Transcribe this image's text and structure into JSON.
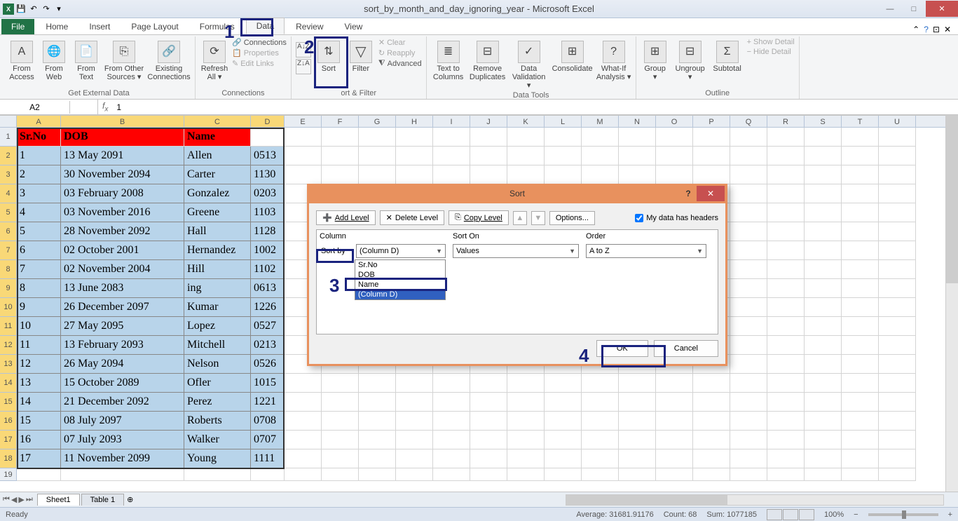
{
  "title": "sort_by_month_and_day_ignoring_year - Microsoft Excel",
  "tabs": [
    "File",
    "Home",
    "Insert",
    "Page Layout",
    "Formulas",
    "Data",
    "Review",
    "View"
  ],
  "active_tab": "Data",
  "ribbon": {
    "get_ext": {
      "from_access": "From\nAccess",
      "from_web": "From\nWeb",
      "from_text": "From\nText",
      "from_other": "From Other\nSources ▾",
      "existing": "Existing\nConnections",
      "label": "Get External Data"
    },
    "conn": {
      "refresh": "Refresh\nAll ▾",
      "connections": "Connections",
      "properties": "Properties",
      "edit_links": "Edit Links",
      "label": "Connections"
    },
    "sort": {
      "sort": "Sort",
      "filter": "Filter",
      "clear": "Clear",
      "reapply": "Reapply",
      "advanced": "Advanced",
      "label": "ort & Filter"
    },
    "tools": {
      "ttc": "Text to\nColumns",
      "rd": "Remove\nDuplicates",
      "dv": "Data\nValidation ▾",
      "cons": "Consolidate",
      "wia": "What-If\nAnalysis ▾",
      "label": "Data Tools"
    },
    "outline": {
      "group": "Group\n▾",
      "ungroup": "Ungroup\n▾",
      "subtotal": "Subtotal",
      "show": "Show Detail",
      "hide": "Hide Detail",
      "label": "Outline"
    }
  },
  "namebox": "A2",
  "formula": "1",
  "col_widths": {
    "A": 63,
    "B": 176,
    "C": 95,
    "D": 48,
    "rest": 53
  },
  "columns": [
    "A",
    "B",
    "C",
    "D",
    "E",
    "F",
    "G",
    "H",
    "I",
    "J",
    "K",
    "L",
    "M",
    "N",
    "O",
    "P",
    "Q",
    "R",
    "S",
    "T",
    "U"
  ],
  "headers": {
    "A": "Sr.No",
    "B": "DOB",
    "C": "Name"
  },
  "table": [
    {
      "A": "1",
      "B": "13 May 2091",
      "C": "Allen",
      "D": "0513"
    },
    {
      "A": "2",
      "B": "30 November 2094",
      "C": "Carter",
      "D": "1130"
    },
    {
      "A": "3",
      "B": "03 February 2008",
      "C": "Gonzalez",
      "D": "0203"
    },
    {
      "A": "4",
      "B": "03 November 2016",
      "C": "Greene",
      "D": "1103"
    },
    {
      "A": "5",
      "B": "28 November 2092",
      "C": "Hall",
      "D": "1128"
    },
    {
      "A": "6",
      "B": "02 October 2001",
      "C": "Hernandez",
      "D": "1002"
    },
    {
      "A": "7",
      "B": "02 November 2004",
      "C": "Hill",
      "D": "1102"
    },
    {
      "A": "8",
      "B": "13 June 2083",
      "C": "ing",
      "D": "0613"
    },
    {
      "A": "9",
      "B": "26 December 2097",
      "C": "Kumar",
      "D": "1226"
    },
    {
      "A": "10",
      "B": "27 May 2095",
      "C": "Lopez",
      "D": "0527"
    },
    {
      "A": "11",
      "B": "13 February 2093",
      "C": "Mitchell",
      "D": "0213"
    },
    {
      "A": "12",
      "B": "26 May 2094",
      "C": "Nelson",
      "D": "0526"
    },
    {
      "A": "13",
      "B": "15 October 2089",
      "C": "Ofler",
      "D": "1015"
    },
    {
      "A": "14",
      "B": "21 December 2092",
      "C": "Perez",
      "D": "1221"
    },
    {
      "A": "15",
      "B": "08 July 2097",
      "C": "Roberts",
      "D": "0708"
    },
    {
      "A": "16",
      "B": "07 July 2093",
      "C": "Walker",
      "D": "0707"
    },
    {
      "A": "17",
      "B": "11 November 2099",
      "C": "Young",
      "D": "1111"
    }
  ],
  "dialog": {
    "title": "Sort",
    "add": "Add Level",
    "delete": "Delete Level",
    "copy": "Copy Level",
    "options": "Options...",
    "check_label": "My data has headers",
    "h_col": "Column",
    "h_sorton": "Sort On",
    "h_order": "Order",
    "sortby_label": "Sort by",
    "col_val": "(Column D)",
    "sorton_val": "Values",
    "order_val": "A to Z",
    "dd_items": [
      "Sr.No",
      "DOB",
      "Name",
      "(Column D)"
    ],
    "ok": "OK",
    "cancel": "Cancel"
  },
  "annotations": {
    "1": "1",
    "2": "2",
    "3": "3",
    "4": "4"
  },
  "sheets": [
    "Sheet1",
    "Table 1"
  ],
  "status": {
    "ready": "Ready",
    "avg": "Average: 31681.91176",
    "count": "Count: 68",
    "sum": "Sum: 1077185",
    "zoom": "100%"
  }
}
